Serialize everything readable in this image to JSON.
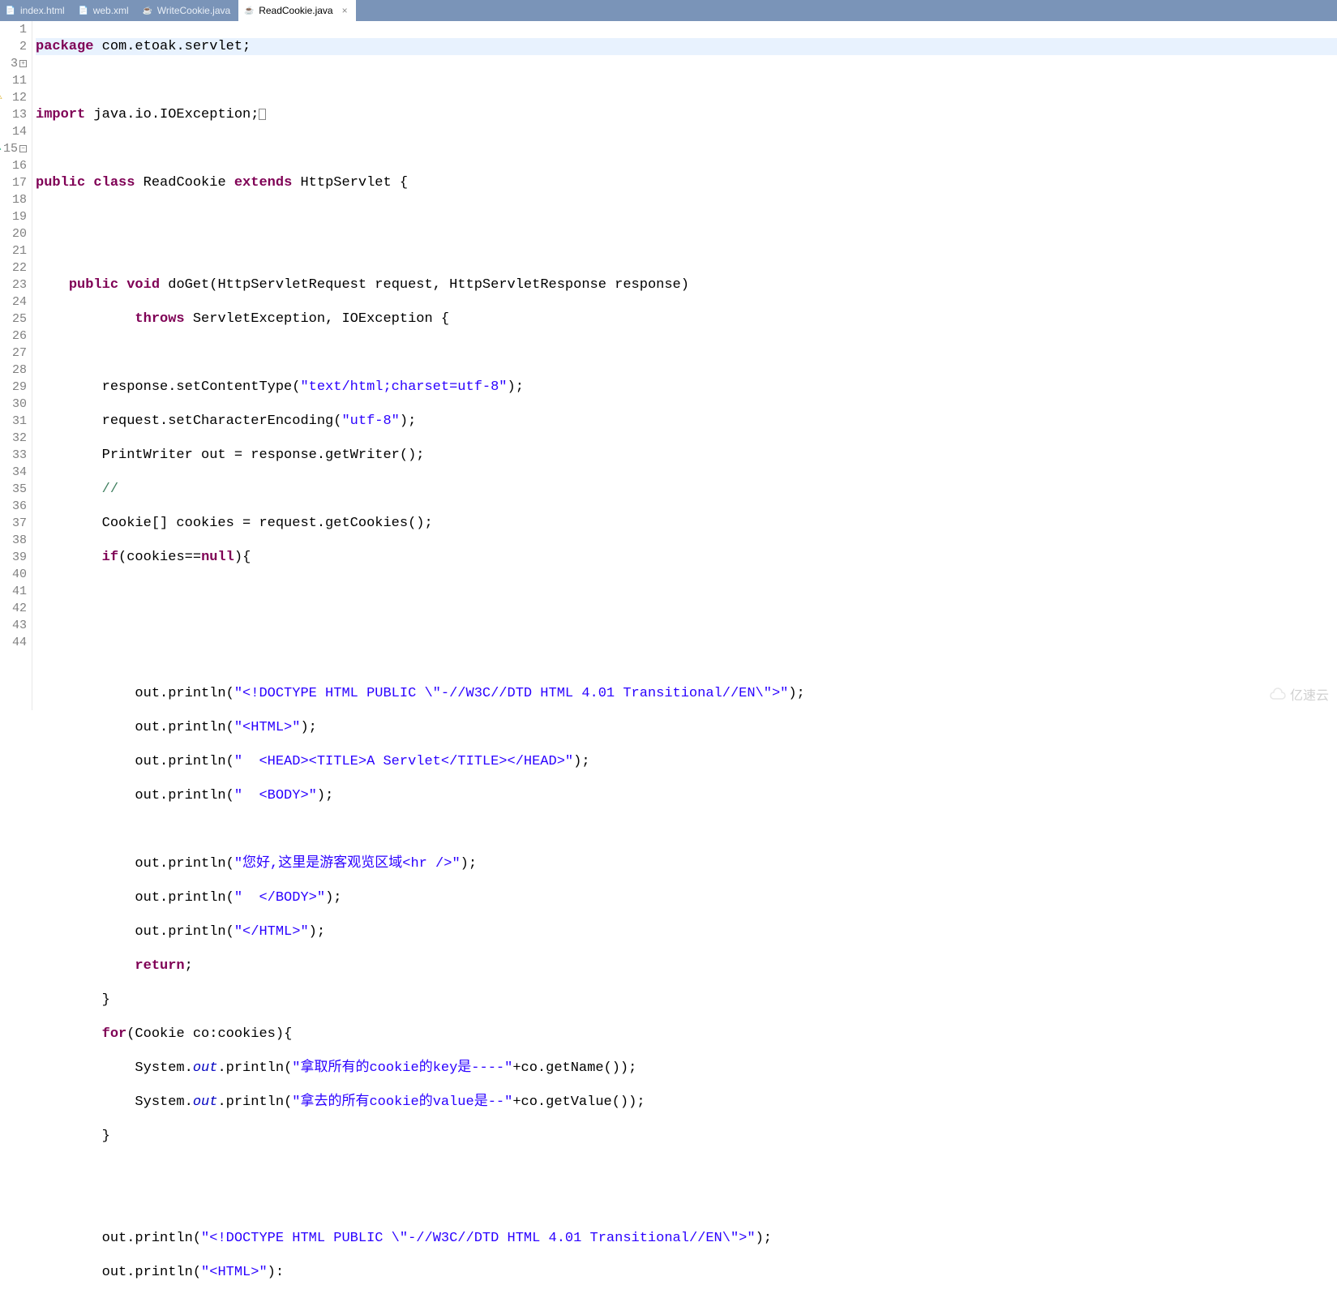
{
  "tabs": [
    {
      "label": "index.html",
      "icon": "H"
    },
    {
      "label": "web.xml",
      "icon": "X"
    },
    {
      "label": "WriteCookie.java",
      "icon": "J"
    },
    {
      "label": "ReadCookie.java",
      "icon": "J",
      "active": true
    }
  ],
  "gutter": {
    "lines": [
      "1",
      "2",
      "3",
      "11",
      "12",
      "13",
      "14",
      "15",
      "16",
      "17",
      "18",
      "19",
      "20",
      "21",
      "22",
      "23",
      "24",
      "25",
      "26",
      "27",
      "28",
      "29",
      "30",
      "31",
      "32",
      "33",
      "34",
      "35",
      "36",
      "37",
      "38",
      "39",
      "40",
      "41",
      "42",
      "43",
      "44"
    ]
  },
  "code": {
    "l1_kw": "package",
    "l1_rest": " com.etoak.servlet;",
    "l3_kw": "import",
    "l3_rest": " java.io.IOException;",
    "l12_a": "public",
    "l12_b": "class",
    "l12_c": " ReadCookie ",
    "l12_d": "extends",
    "l12_e": " HttpServlet {",
    "l15_a": "public",
    "l15_b": "void",
    "l15_c": " doGet(HttpServletRequest request, HttpServletResponse response)",
    "l16_a": "throws",
    "l16_b": " ServletException, IOException {",
    "l18_a": "        response.setContentType(",
    "l18_s": "\"text/html;charset=utf-8\"",
    "l18_b": ");",
    "l19_a": "        request.setCharacterEncoding(",
    "l19_s": "\"utf-8\"",
    "l19_b": ");",
    "l20": "        PrintWriter out = response.getWriter();",
    "l21": "        //",
    "l22": "        Cookie[] cookies = request.getCookies();",
    "l23_a": "        ",
    "l23_kw": "if",
    "l23_b": "(cookies==",
    "l23_kw2": "null",
    "l23_c": "){",
    "l27_a": "            out.println(",
    "l27_s": "\"<!DOCTYPE HTML PUBLIC \\\"-//W3C//DTD HTML 4.01 Transitional//EN\\\">\"",
    "l27_b": ");",
    "l28_a": "            out.println(",
    "l28_s": "\"<HTML>\"",
    "l28_b": ");",
    "l29_a": "            out.println(",
    "l29_s": "\"  <HEAD><TITLE>A Servlet</TITLE></HEAD>\"",
    "l29_b": ");",
    "l30_a": "            out.println(",
    "l30_s": "\"  <BODY>\"",
    "l30_b": ");",
    "l32_a": "            out.println(",
    "l32_s": "\"您好,这里是游客观览区域<hr />\"",
    "l32_b": ");",
    "l33_a": "            out.println(",
    "l33_s": "\"  </BODY>\"",
    "l33_b": ");",
    "l34_a": "            out.println(",
    "l34_s": "\"</HTML>\"",
    "l34_b": ");",
    "l35_a": "            ",
    "l35_kw": "return",
    "l35_b": ";",
    "l36": "        }",
    "l37_a": "        ",
    "l37_kw": "for",
    "l37_b": "(Cookie co:cookies){",
    "l38_a": "            System.",
    "l38_f": "out",
    "l38_b": ".println(",
    "l38_s": "\"拿取所有的cookie的key是----\"",
    "l38_c": "+co.getName());",
    "l39_a": "            System.",
    "l39_f": "out",
    "l39_b": ".println(",
    "l39_s": "\"拿去的所有cookie的value是--\"",
    "l39_c": "+co.getValue());",
    "l40": "        }",
    "l43_a": "        out.println(",
    "l43_s": "\"<!DOCTYPE HTML PUBLIC \\\"-//W3C//DTD HTML 4.01 Transitional//EN\\\">\"",
    "l43_b": ");",
    "l44_a": "        out.println(",
    "l44_s": "\"<HTML>\"",
    "l44_b": "):"
  },
  "watermark": "亿速云"
}
